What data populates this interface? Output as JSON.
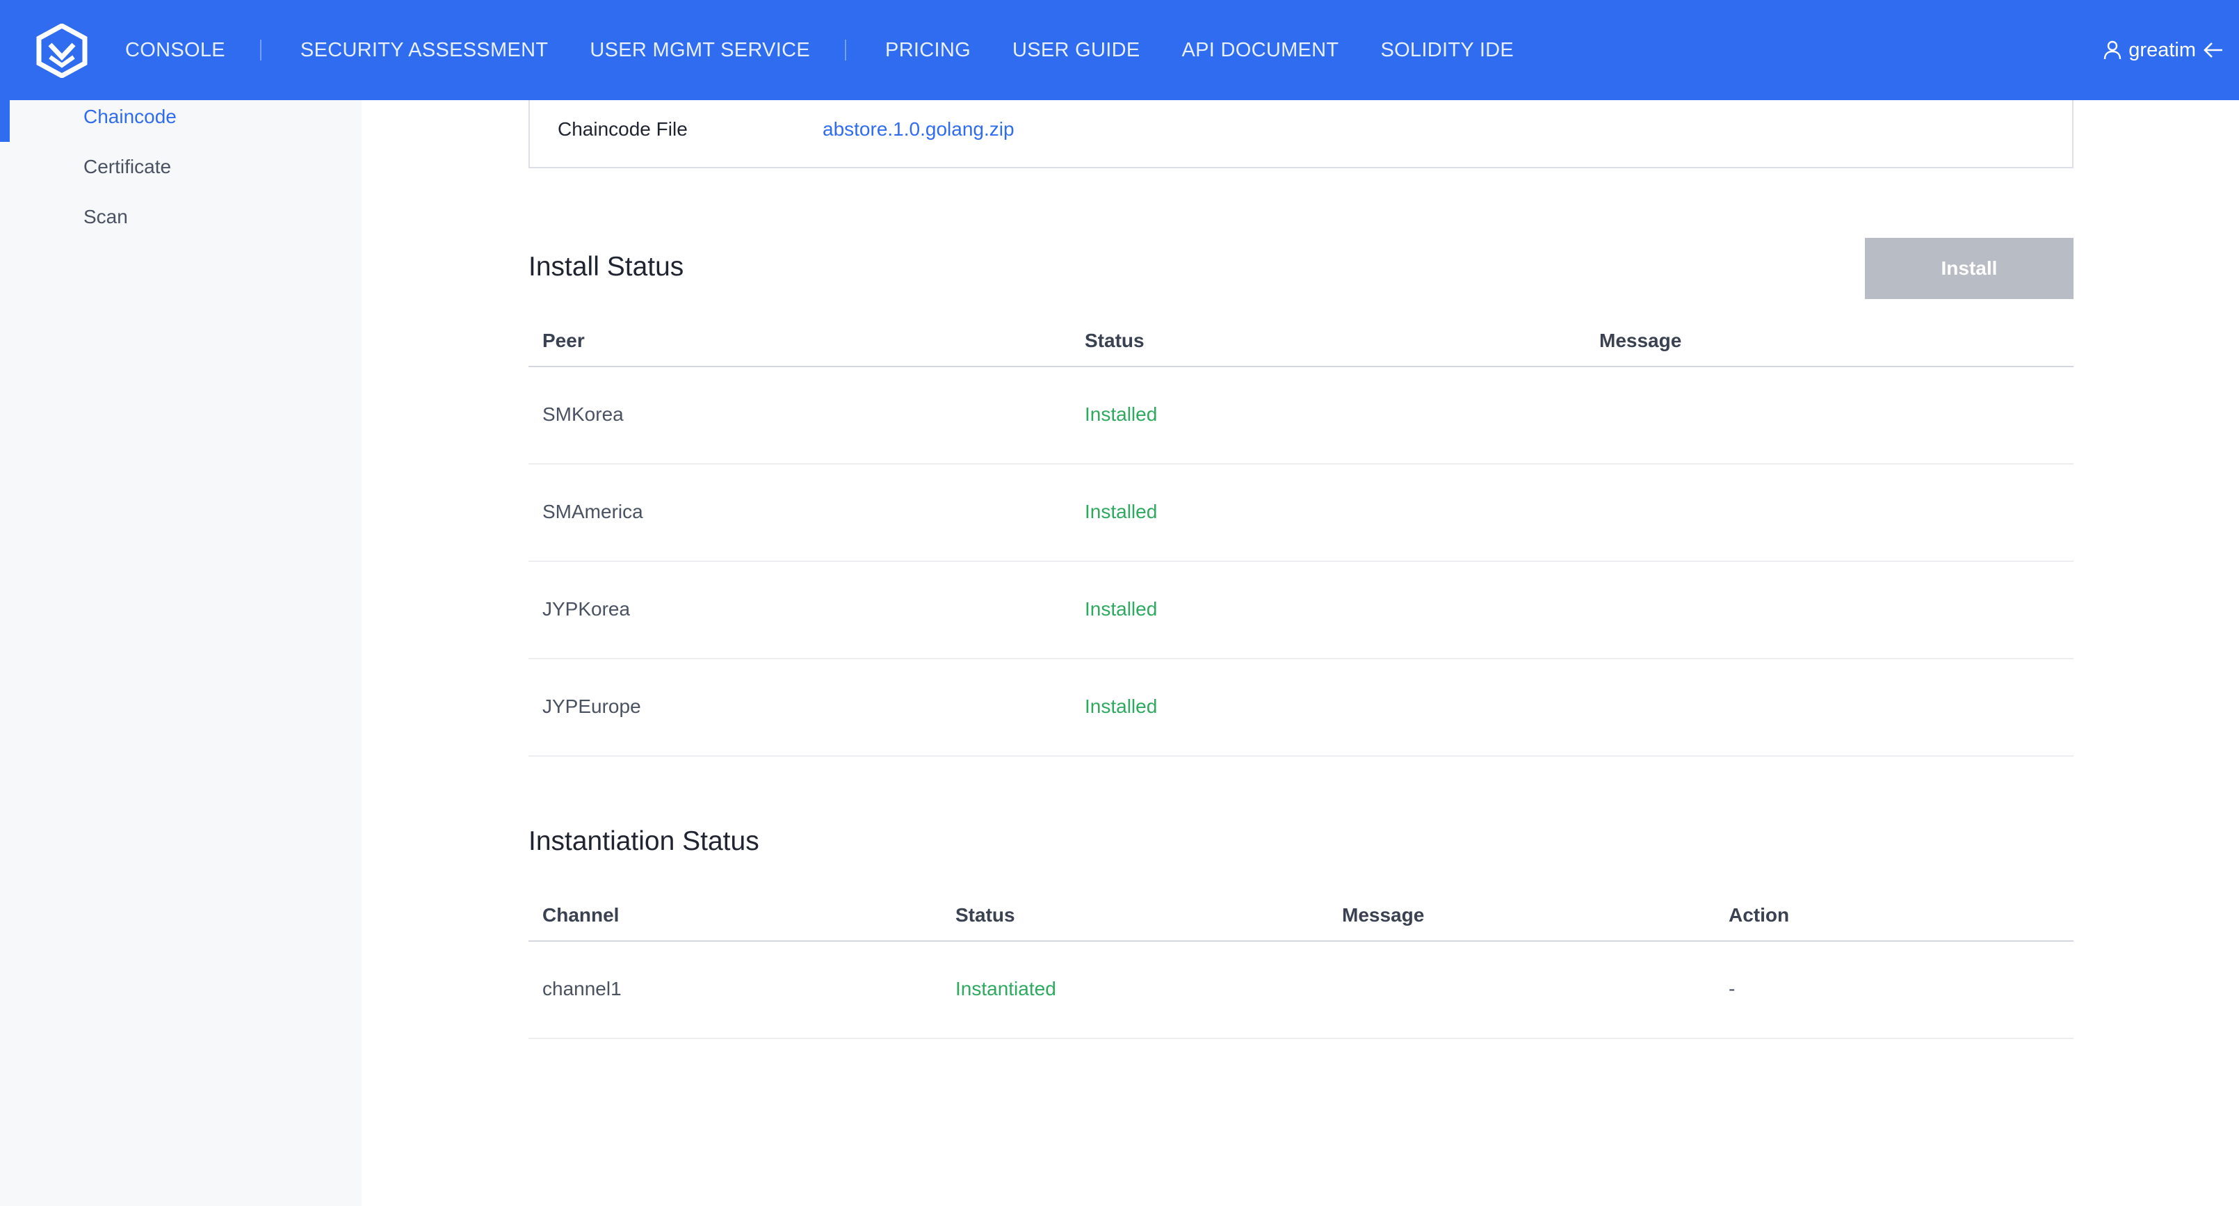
{
  "header": {
    "nav": [
      {
        "label": "CONSOLE"
      },
      {
        "label": "SECURITY ASSESSMENT"
      },
      {
        "label": "USER MGMT SERVICE"
      },
      {
        "label": "PRICING"
      },
      {
        "label": "USER GUIDE"
      },
      {
        "label": "API DOCUMENT"
      },
      {
        "label": "SOLIDITY IDE"
      }
    ],
    "username": "greatim",
    "user_icon": "user-icon",
    "logout_icon": "arrow-left-icon"
  },
  "sidebar": {
    "items": [
      {
        "label": "Chaincode",
        "active": true
      },
      {
        "label": "Certificate",
        "active": false
      },
      {
        "label": "Scan",
        "active": false
      }
    ]
  },
  "file": {
    "label": "Chaincode File",
    "value": "abstore.1.0.golang.zip"
  },
  "install": {
    "title": "Install Status",
    "button_label": "Install",
    "columns": [
      "Peer",
      "Status",
      "Message"
    ],
    "rows": [
      {
        "peer": "SMKorea",
        "status": "Installed",
        "message": ""
      },
      {
        "peer": "SMAmerica",
        "status": "Installed",
        "message": ""
      },
      {
        "peer": "JYPKorea",
        "status": "Installed",
        "message": ""
      },
      {
        "peer": "JYPEurope",
        "status": "Installed",
        "message": ""
      }
    ]
  },
  "instantiation": {
    "title": "Instantiation Status",
    "columns": [
      "Channel",
      "Status",
      "Message",
      "Action"
    ],
    "rows": [
      {
        "channel": "channel1",
        "status": "Instantiated",
        "message": "",
        "action": "-"
      }
    ]
  },
  "colors": {
    "brand": "#2f6cf0",
    "success": "#2daa5f",
    "disabled_button": "#b8bcc4"
  }
}
